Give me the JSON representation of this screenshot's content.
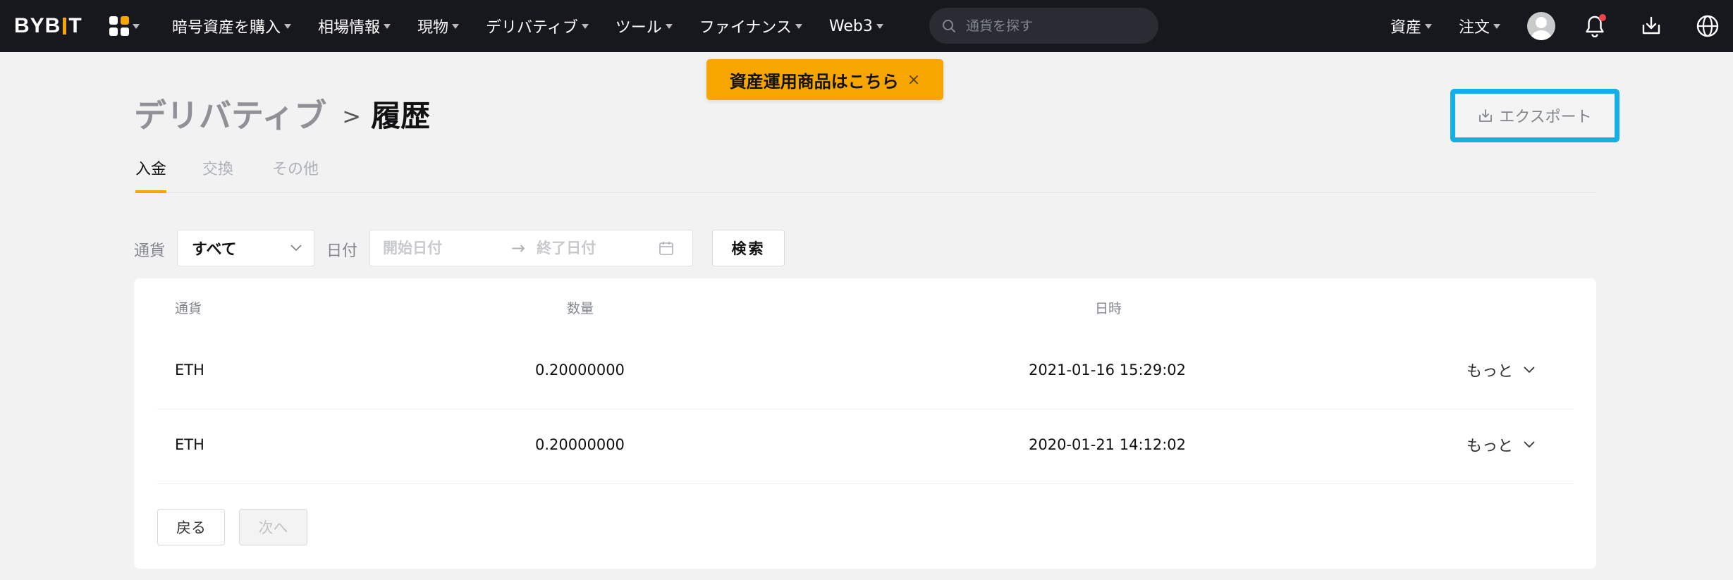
{
  "logo": {
    "left": "BYB",
    "right": "T"
  },
  "nav": {
    "items": [
      "暗号資産を購入",
      "相場情報",
      "現物",
      "デリバティブ",
      "ツール",
      "ファイナンス",
      "Web3"
    ],
    "search_placeholder": "通貨を探す",
    "right_items": [
      "資産",
      "注文"
    ]
  },
  "banner": {
    "text": "資産運用商品はこちら",
    "close": "×"
  },
  "breadcrumb": {
    "parent": "デリバティブ",
    "separator": ">",
    "current": "履歴"
  },
  "export_label": "エクスポート",
  "tabs": [
    "入金",
    "交換",
    "その他"
  ],
  "filters": {
    "currency_label": "通貨",
    "currency_value": "すべて",
    "date_label": "日付",
    "start_placeholder": "開始日付",
    "end_placeholder": "終了日付",
    "arrow": "→",
    "search_label": "検索"
  },
  "table": {
    "headers": [
      "通貨",
      "数量",
      "日時"
    ],
    "rows": [
      {
        "currency": "ETH",
        "amount": "0.20000000",
        "datetime": "2021-01-16 15:29:02",
        "more": "もっと"
      },
      {
        "currency": "ETH",
        "amount": "0.20000000",
        "datetime": "2020-01-21 14:12:02",
        "more": "もっと"
      }
    ]
  },
  "pagination": {
    "prev": "戻る",
    "next": "次へ"
  },
  "colors": {
    "accent": "#f7a600",
    "highlight_border": "#16aee6",
    "topbar": "#17181e"
  }
}
